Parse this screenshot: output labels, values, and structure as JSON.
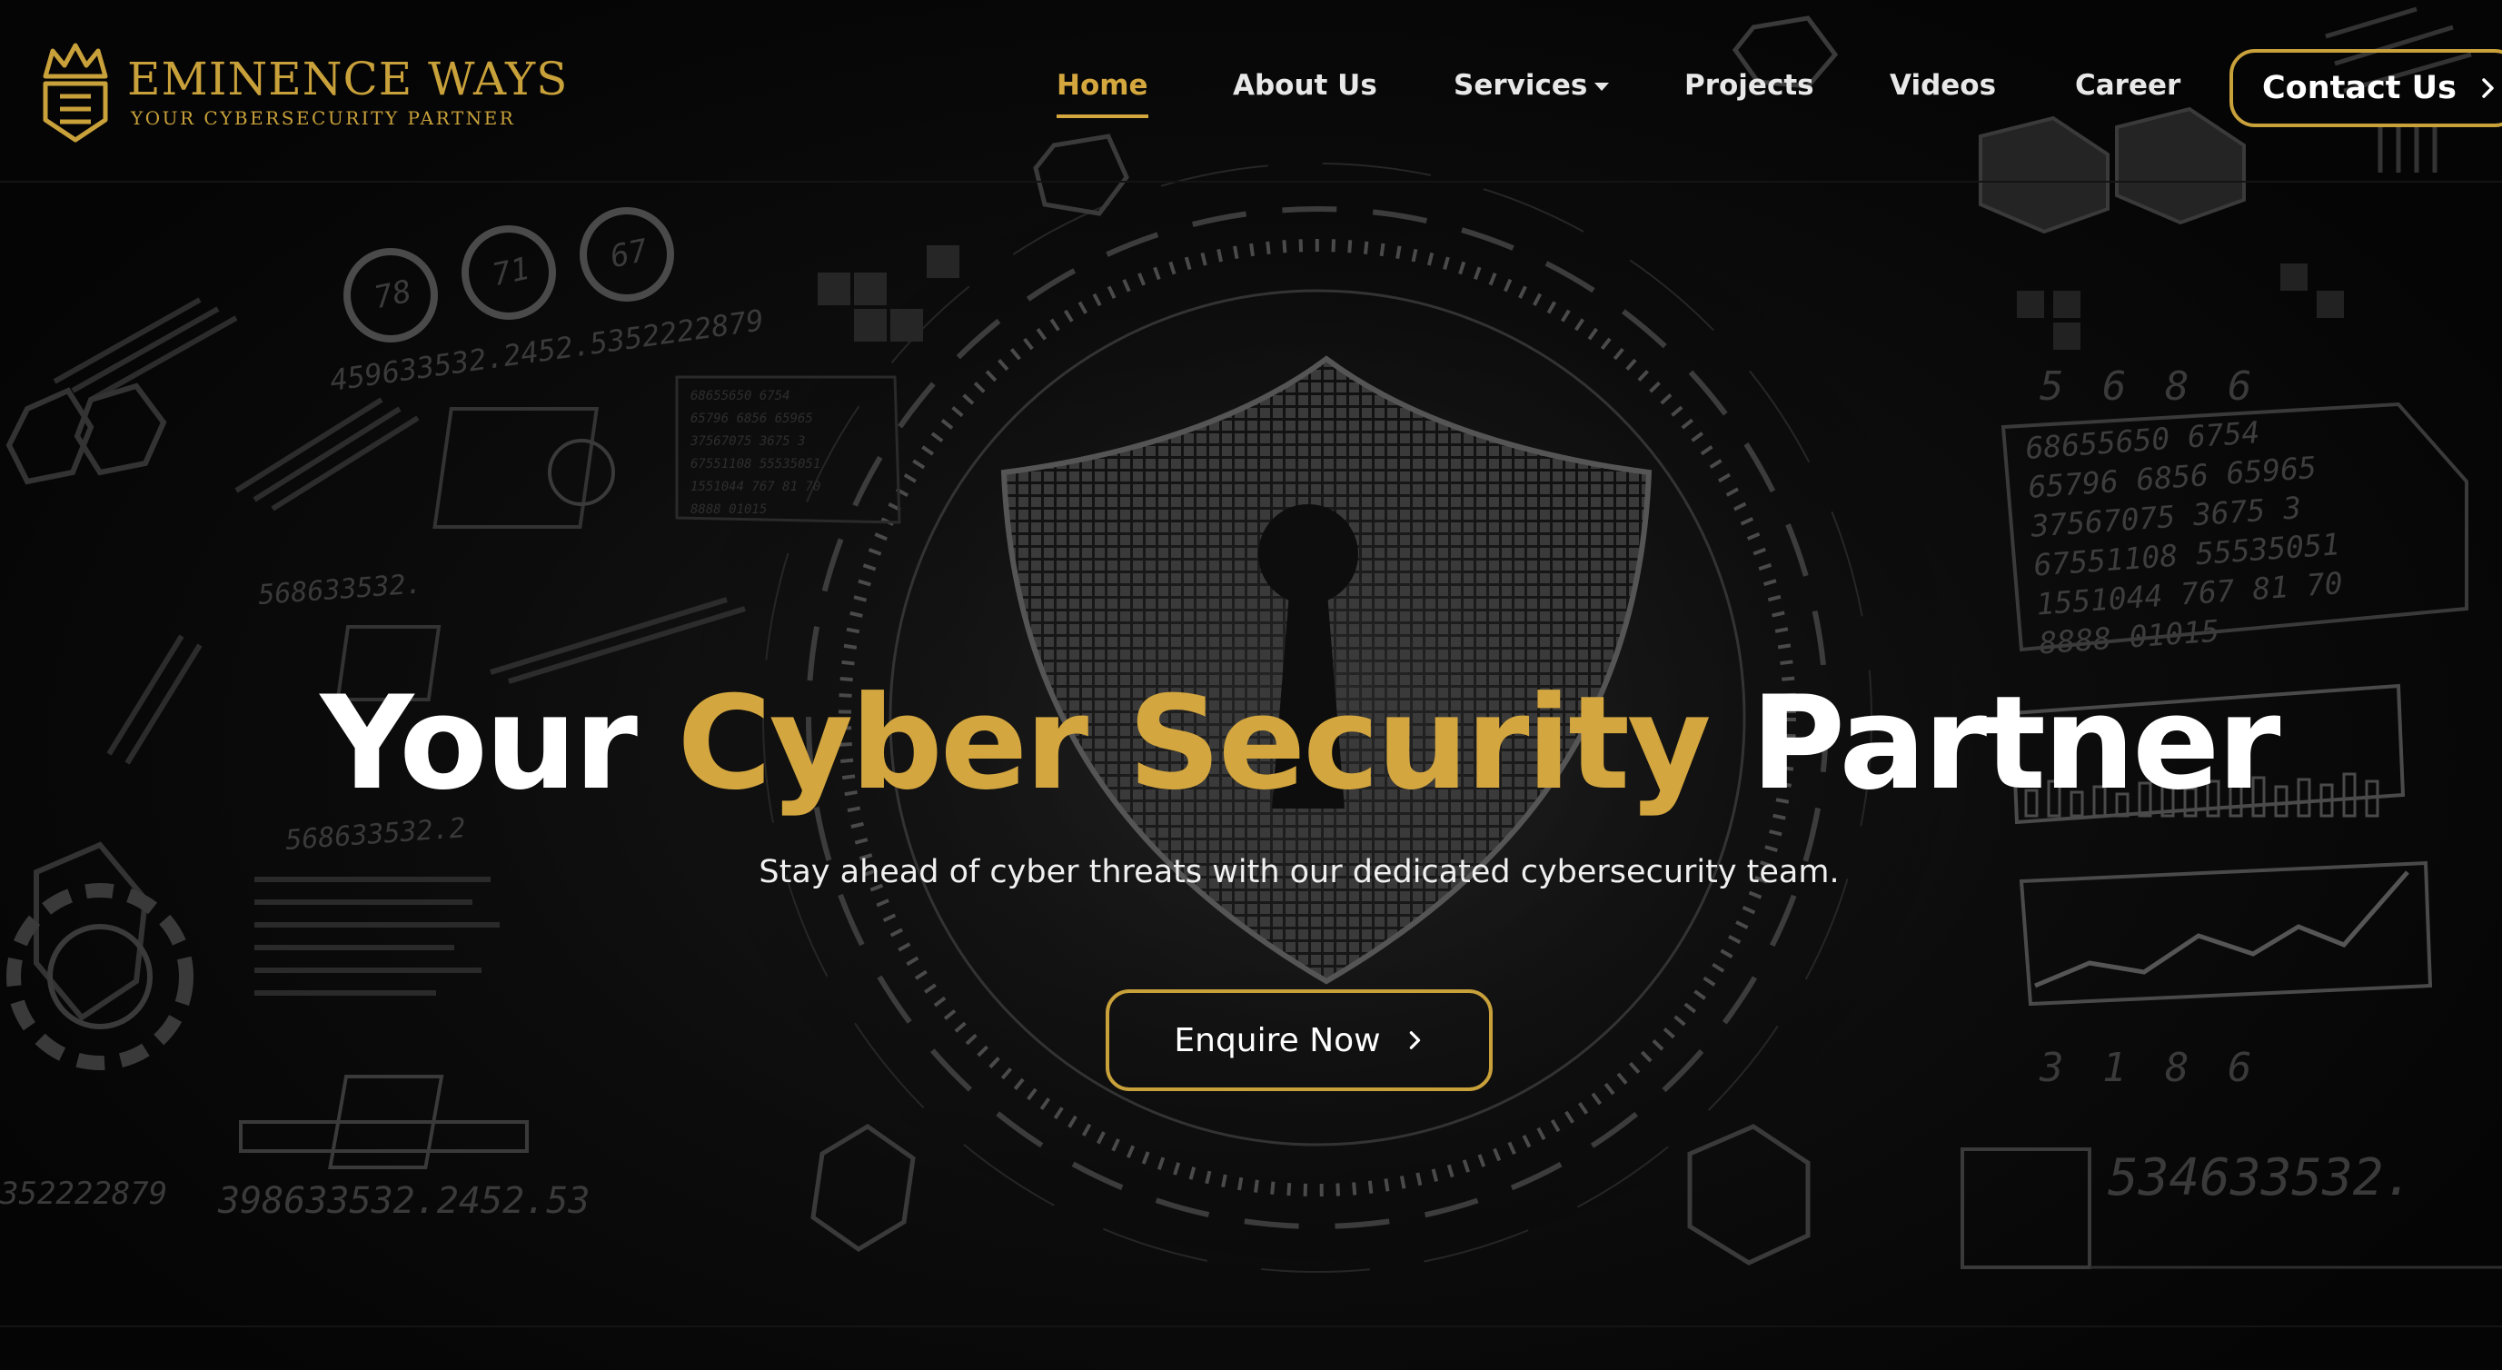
{
  "brand": {
    "name": "Eminence Ways",
    "name_display": "EMINENCE WAYS",
    "tagline": "Your Cybersecurity Partner",
    "tagline_display": "YOUR CYBERSECURITY PARTNER"
  },
  "nav": {
    "items": [
      {
        "label": "Home",
        "active": true
      },
      {
        "label": "About Us",
        "active": false
      },
      {
        "label": "Services",
        "active": false,
        "dropdown": true
      },
      {
        "label": "Projects",
        "active": false
      },
      {
        "label": "Videos",
        "active": false
      },
      {
        "label": "Career",
        "active": false
      }
    ],
    "contact_label": "Contact Us"
  },
  "hero": {
    "title_part1": "Your",
    "title_highlight": "Cyber Security",
    "title_part2": "Partner",
    "subtitle": "Stay ahead of cyber threats with our dedicated cybersecurity team.",
    "cta_label": "Enquire Now"
  },
  "background_numbers": {
    "left_top": "459633532.2452.5352222879",
    "left_mid1": "568633532.",
    "left_mid2": "568633532.2",
    "left_bottom1": "352222879",
    "left_bottom2": "398633532.2452.53",
    "gauge_1": "78",
    "gauge_2": "71",
    "gauge_3": "67",
    "right_top": "5 6 8 6",
    "right_block": [
      "68655650  6754",
      "65796 6856 65965",
      "37567075  3675  3",
      "67551108  55535051",
      "1551044 767 81 70",
      "8888 01015"
    ],
    "right_mid": "3 1 8 6",
    "right_bottom": "534633532."
  },
  "colors": {
    "accent": "#d3a63f",
    "background": "#050505",
    "text": "#ffffff"
  },
  "icons": [
    "crown-shield-logo-icon",
    "caret-down-icon",
    "chevron-right-icon",
    "shield-keyhole-icon"
  ]
}
